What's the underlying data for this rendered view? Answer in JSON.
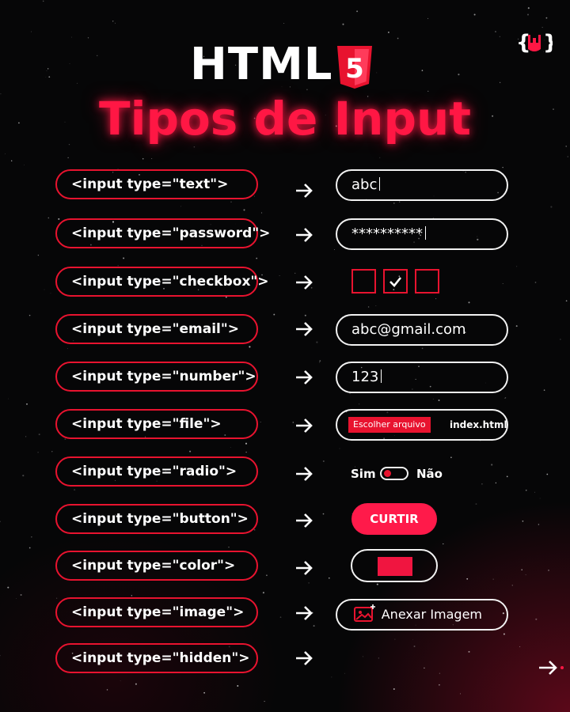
{
  "header": {
    "title": "HTML",
    "badge_number": "5",
    "subtitle": "Tipos de Input",
    "logo_icon": "rock-hand-braces-icon"
  },
  "colors": {
    "accent": "#e8132f",
    "accent_bright": "#ff1a4a",
    "background": "#060607",
    "text": "#ffffff"
  },
  "rows": [
    {
      "code": "<input type=\"text\">",
      "example": "abc"
    },
    {
      "code": "<input type=\"password\">",
      "example": "**********"
    },
    {
      "code": "<input type=\"checkbox\">",
      "example_checked": [
        false,
        true,
        false
      ]
    },
    {
      "code": "<input type=\"email\">",
      "example": "abc@gmail.com"
    },
    {
      "code": "<input type=\"number\">",
      "example": "123"
    },
    {
      "code": "<input type=\"file\">",
      "button": "Escolher arquivo",
      "filename": "index.html"
    },
    {
      "code": "<input type=\"radio\">",
      "left": "Sim",
      "right": "Não",
      "selected": "Sim"
    },
    {
      "code": "<input type=\"button\">",
      "button": "CURTIR"
    },
    {
      "code": "<input type=\"color\">",
      "color": "#f01540"
    },
    {
      "code": "<input type=\"image\">",
      "button": "Anexar Imagem",
      "icon": "image-add-icon"
    },
    {
      "code": "<input type=\"hidden\">"
    }
  ],
  "footer": {
    "next_icon": "arrow-right-icon"
  }
}
